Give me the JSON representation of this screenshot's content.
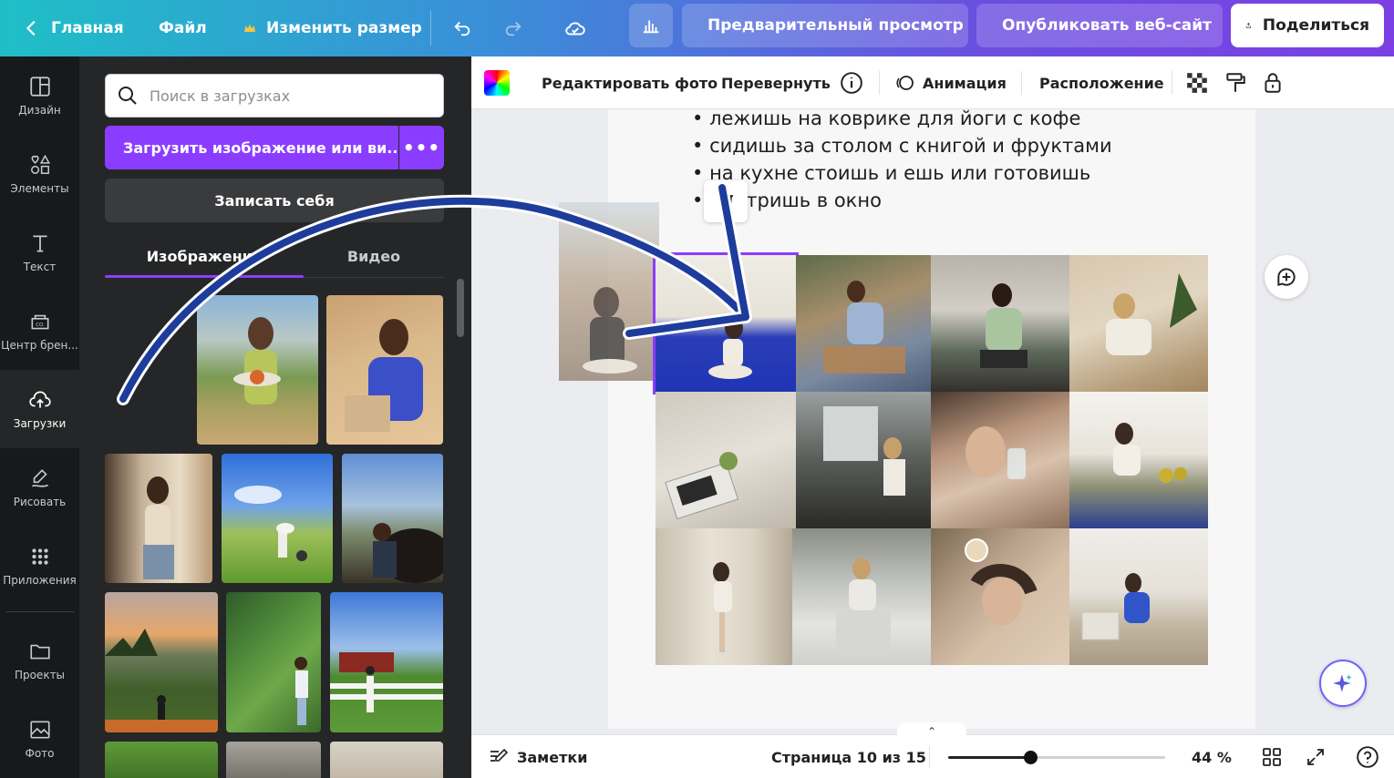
{
  "topbar": {
    "home": "Главная",
    "file": "Файл",
    "resize": "Изменить размер",
    "preview": "Предварительный просмотр",
    "publish": "Опубликовать веб-сайт",
    "share": "Поделиться"
  },
  "leftnav": {
    "items": [
      {
        "label": "Дизайн",
        "icon": "layout-icon"
      },
      {
        "label": "Элементы",
        "icon": "elements-icon"
      },
      {
        "label": "Текст",
        "icon": "text-icon"
      },
      {
        "label": "Центр брен...",
        "icon": "brand-icon"
      },
      {
        "label": "Загрузки",
        "icon": "upload-cloud-icon"
      },
      {
        "label": "Рисовать",
        "icon": "draw-icon"
      },
      {
        "label": "Приложения",
        "icon": "apps-icon"
      },
      {
        "label": "Проекты",
        "icon": "folder-icon"
      },
      {
        "label": "Фото",
        "icon": "photo-icon"
      }
    ]
  },
  "panel": {
    "search_placeholder": "Поиск в загрузках",
    "upload_label": "Загрузить изображение или ви...",
    "record_label": "Записать себя",
    "tabs": [
      "Изображения",
      "Видео"
    ]
  },
  "editor_toolbar": {
    "edit_photo": "Редактировать фото",
    "flip": "Перевернуть",
    "animation": "Анимация",
    "position": "Расположение"
  },
  "canvas": {
    "bullets": [
      "лежишь на коврике для йоги с кофе",
      "сидишь за столом с книгой и фруктами",
      "на кухне стоишь и ешь или готовишь",
      "смотришь в окно"
    ]
  },
  "bottombar": {
    "notes": "Заметки",
    "page_info": "Страница 10 из 15",
    "zoom": "44 %",
    "zoom_level": 0.38
  },
  "colors": {
    "accent": "#8b3dff",
    "panel_bg": "#252627",
    "nav_bg": "#18191b",
    "arrow": "#1d3c9c"
  }
}
